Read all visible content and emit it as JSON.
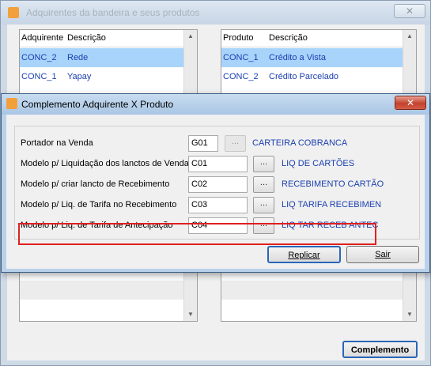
{
  "background_window": {
    "title": "Adquirentes da bandeira e seus produtos",
    "close_glyph": "✕",
    "left_list": {
      "headers": [
        "Adquirente",
        "Descrição"
      ],
      "rows": [
        {
          "code": "CONC_2",
          "desc": "Rede",
          "selected": true
        },
        {
          "code": "CONC_1",
          "desc": "Yapay",
          "selected": false
        }
      ]
    },
    "right_list": {
      "headers": [
        "Produto",
        "Descrição"
      ],
      "rows": [
        {
          "code": "CONC_1",
          "desc": "Crédito a Vista",
          "selected": true
        },
        {
          "code": "CONC_2",
          "desc": "Crédito Parcelado",
          "selected": false
        }
      ]
    },
    "complemento_button": "Complemento"
  },
  "dialog": {
    "title": "Complemento Adquirente X Produto",
    "close_glyph": "✕",
    "fields": [
      {
        "label": "Portador na Venda",
        "code": "G01",
        "description": "CARTEIRA COBRANCA",
        "lookup_enabled": false
      },
      {
        "label": "Modelo p/ Liquidação dos lanctos de Venda",
        "code": "C01",
        "description": "LIQ DE CARTÕES",
        "lookup_enabled": true
      },
      {
        "label": "Modelo p/ criar lancto de Recebimento",
        "code": "C02",
        "description": "RECEBIMENTO CARTÃO",
        "lookup_enabled": true
      },
      {
        "label": "Modelo p/ Liq. de Tarifa no Recebimento",
        "code": "C03",
        "description": "LIQ TARIFA RECEBIMEN",
        "lookup_enabled": true
      },
      {
        "label": "Modelo p/ Liq. de Tarifa de Antecipação",
        "code": "C04",
        "description": "LIQ TAR RECEB ANTEC",
        "lookup_enabled": true
      }
    ],
    "lookup_label": "...",
    "replicar_button": "Replicar",
    "sair_button": "Sair"
  },
  "colors": {
    "link_text": "#1a3fb0",
    "selection": "#a8d4fb",
    "highlight_border": "#e02020",
    "dialog_frame": "#b9d1ea"
  }
}
